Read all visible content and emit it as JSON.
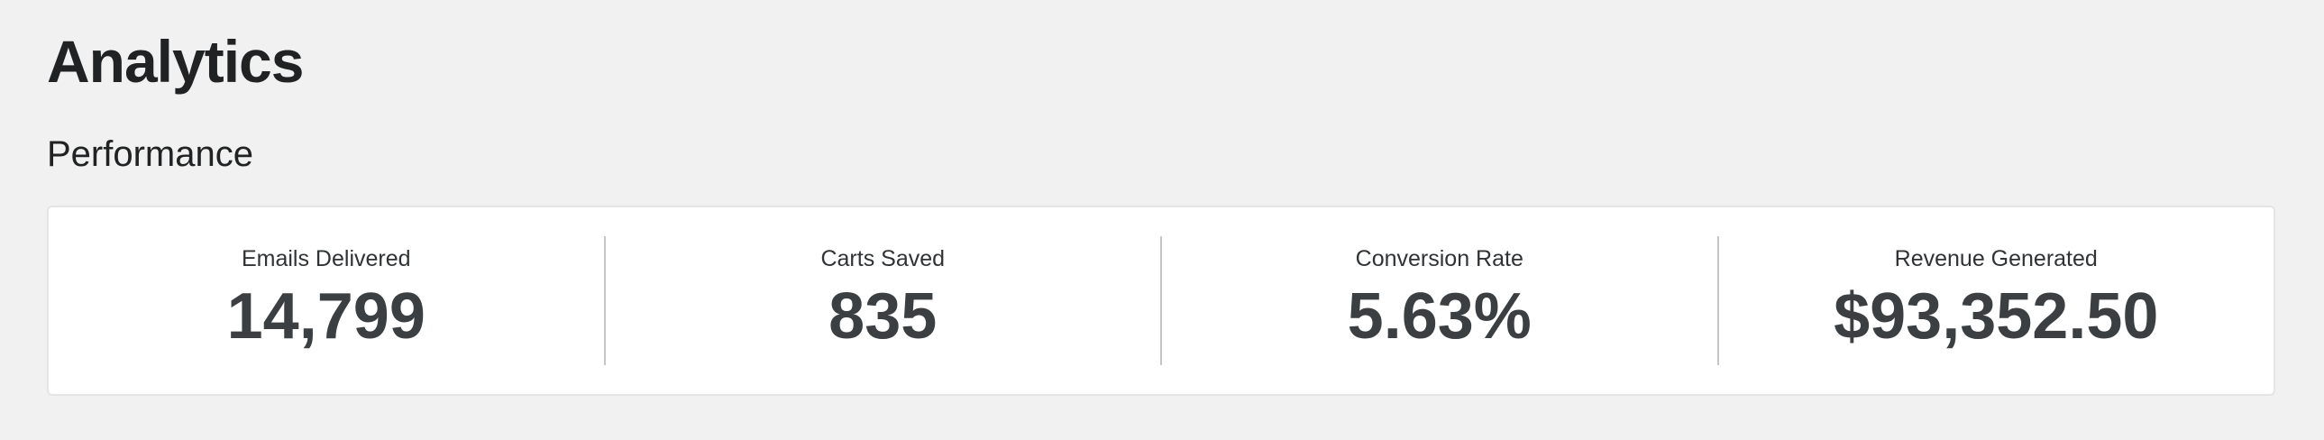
{
  "header": {
    "title": "Analytics"
  },
  "performance": {
    "title": "Performance",
    "stats": [
      {
        "label": "Emails Delivered",
        "value": "14,799"
      },
      {
        "label": "Carts Saved",
        "value": "835"
      },
      {
        "label": "Conversion Rate",
        "value": "5.63%"
      },
      {
        "label": "Revenue Generated",
        "value": "$93,352.50"
      }
    ]
  },
  "colors": {
    "background": "#f1f1f1",
    "card": "#ffffff",
    "text": "#202223",
    "value": "#3b3f42",
    "divider": "#c4c6c8"
  }
}
